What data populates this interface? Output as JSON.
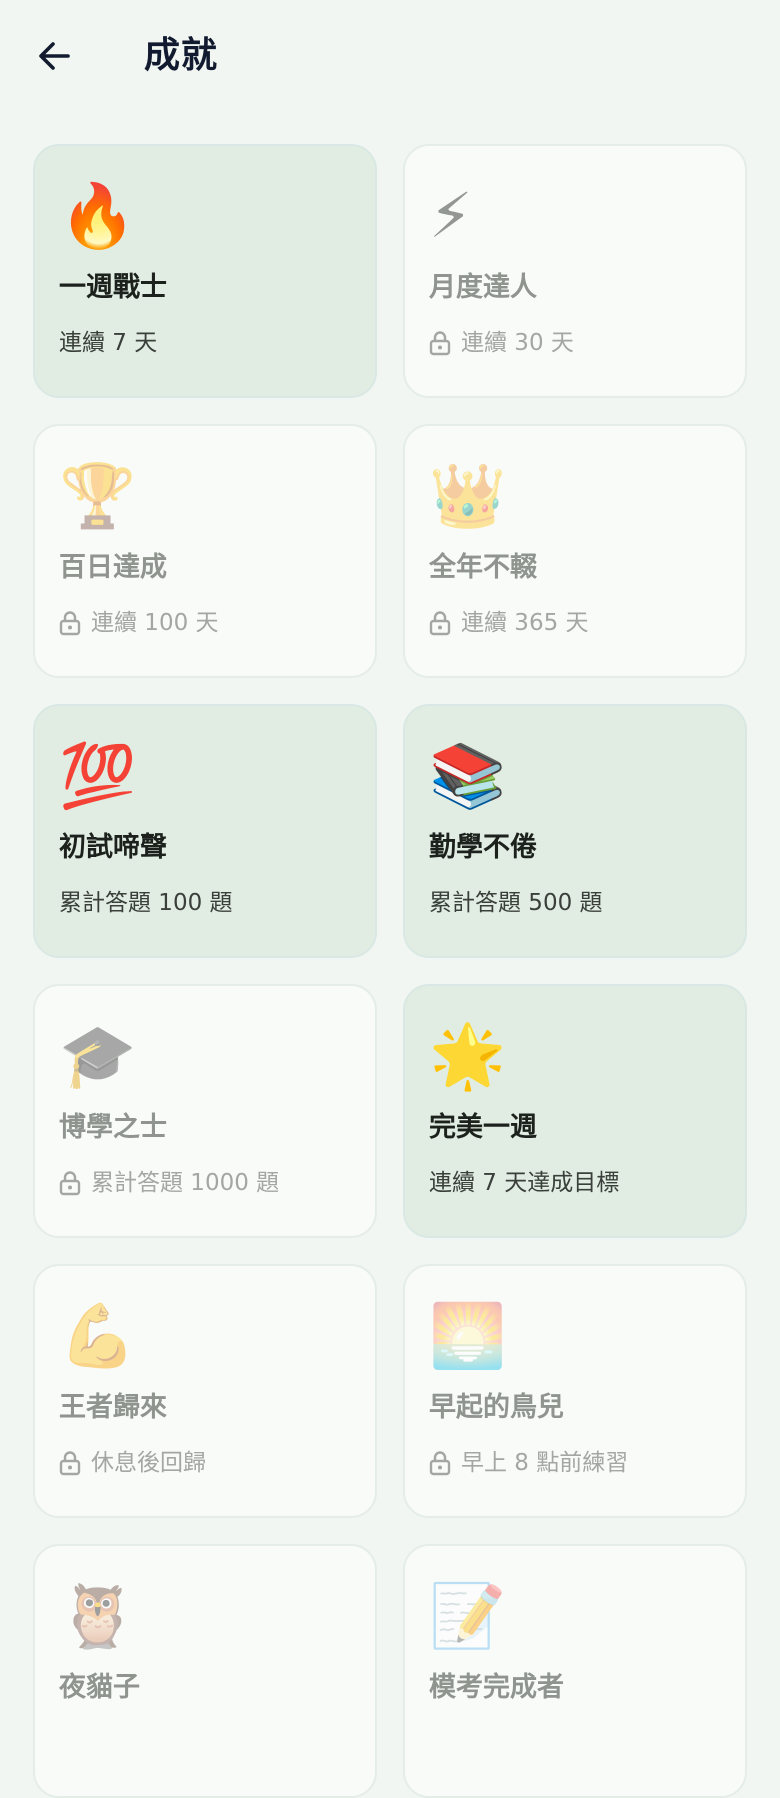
{
  "header": {
    "title": "成就",
    "back_icon": "arrow-left-icon"
  },
  "colors": {
    "background": "#f1f6f2",
    "unlocked_card": "#e1ede2",
    "locked_card": "#f9fbf9",
    "title_text": "#121a30",
    "locked_text": "#8f948f"
  },
  "achievements": [
    {
      "emoji": "🔥",
      "icon": "fire-icon",
      "title": "一週戰士",
      "subtitle": "連續 7 天",
      "unlocked": true
    },
    {
      "emoji": "⚡",
      "icon": "lightning-icon",
      "title": "月度達人",
      "subtitle": "連續 30 天",
      "unlocked": false
    },
    {
      "emoji": "🏆",
      "icon": "trophy-icon",
      "title": "百日達成",
      "subtitle": "連續 100 天",
      "unlocked": false
    },
    {
      "emoji": "👑",
      "icon": "crown-icon",
      "title": "全年不輟",
      "subtitle": "連續 365 天",
      "unlocked": false
    },
    {
      "emoji": "💯",
      "icon": "hundred-points-icon",
      "title": "初試啼聲",
      "subtitle": "累計答題 100 題",
      "unlocked": true
    },
    {
      "emoji": "📚",
      "icon": "books-icon",
      "title": "勤學不倦",
      "subtitle": "累計答題 500 題",
      "unlocked": true
    },
    {
      "emoji": "🎓",
      "icon": "graduation-cap-icon",
      "title": "博學之士",
      "subtitle": "累計答題 1000 題",
      "unlocked": false
    },
    {
      "emoji": "🌟",
      "icon": "glowing-star-icon",
      "title": "完美一週",
      "subtitle": "連續 7 天達成目標",
      "unlocked": true
    },
    {
      "emoji": "💪",
      "icon": "flexed-biceps-icon",
      "title": "王者歸來",
      "subtitle": "休息後回歸",
      "unlocked": false
    },
    {
      "emoji": "🌅",
      "icon": "sunrise-icon",
      "title": "早起的鳥兒",
      "subtitle": "早上 8 點前練習",
      "unlocked": false
    },
    {
      "emoji": "🦉",
      "icon": "owl-icon",
      "title": "夜貓子",
      "subtitle": "",
      "unlocked": false
    },
    {
      "emoji": "📝",
      "icon": "memo-icon",
      "title": "模考完成者",
      "subtitle": "",
      "unlocked": false
    }
  ]
}
